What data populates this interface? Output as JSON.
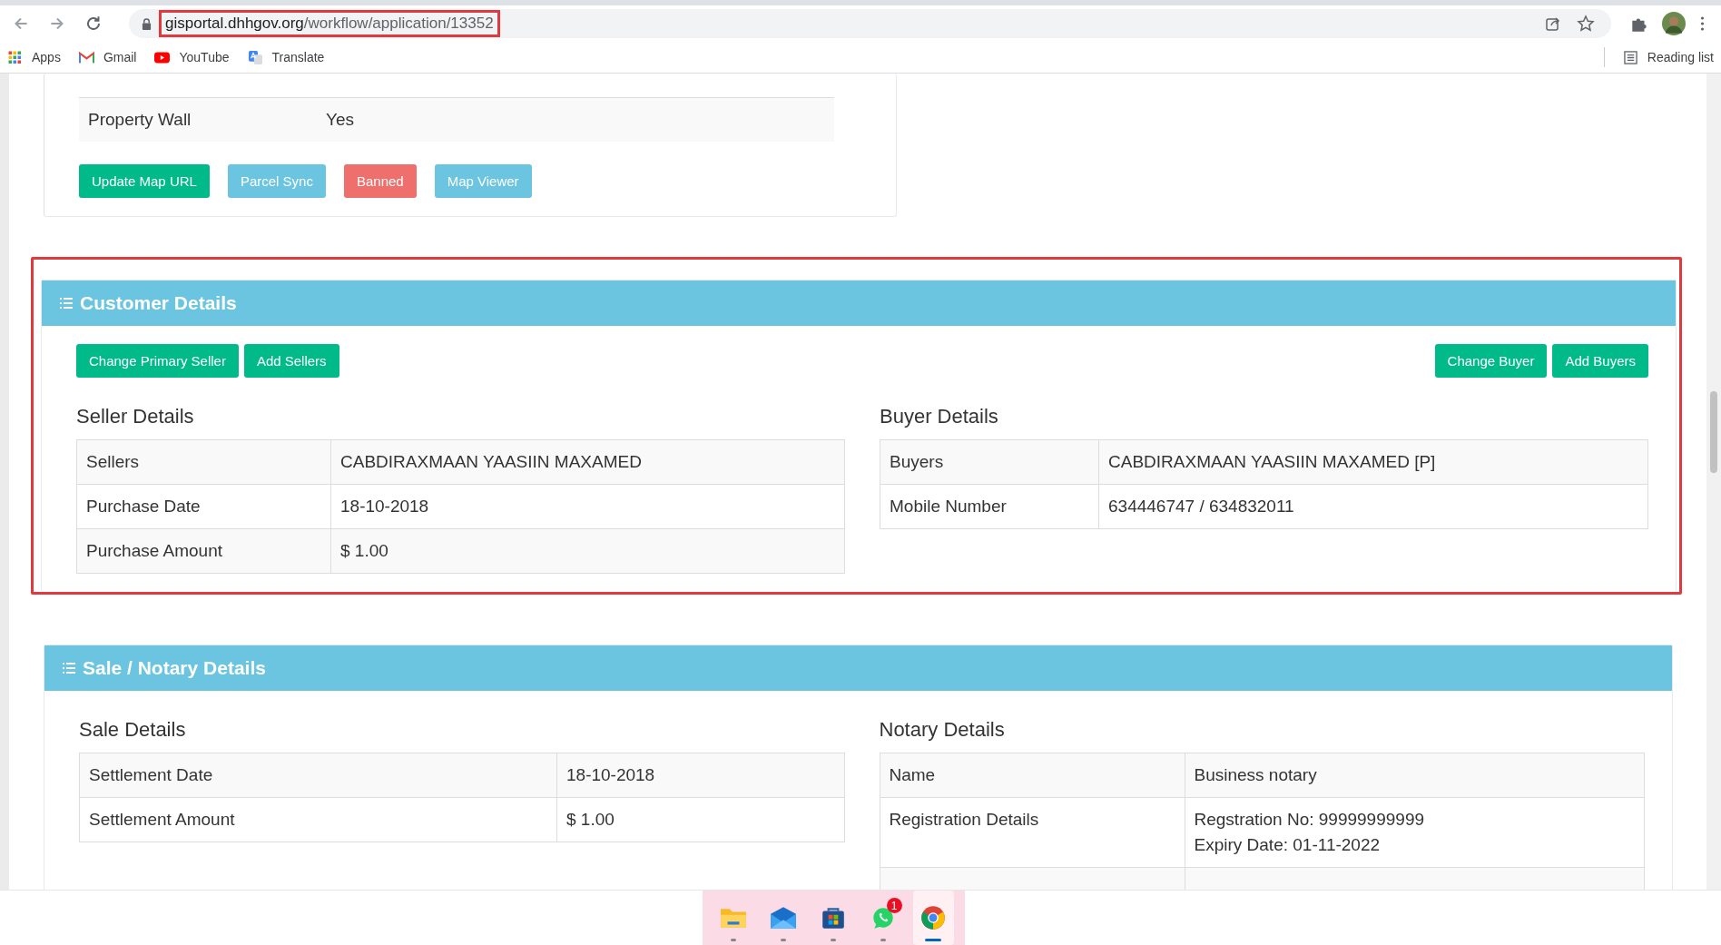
{
  "browser": {
    "url_host": "gisportal.dhhgov.org",
    "url_path": "/workflow/application/13352",
    "url_highlighted": true,
    "bookmarks": [
      {
        "kind": "apps",
        "label": "Apps"
      },
      {
        "kind": "gmail",
        "label": "Gmail"
      },
      {
        "kind": "youtube",
        "label": "YouTube"
      },
      {
        "kind": "translate",
        "label": "Translate"
      }
    ],
    "reading_list": "Reading list"
  },
  "property_table": {
    "rows": [
      {
        "label": "Property Wall",
        "value": "Yes"
      }
    ]
  },
  "property_actions": [
    {
      "label": "Update Map URL",
      "kind": "success"
    },
    {
      "label": "Parcel Sync",
      "kind": "info"
    },
    {
      "label": "Banned",
      "kind": "danger"
    },
    {
      "label": "Map Viewer",
      "kind": "info"
    }
  ],
  "customer_section": {
    "title": "Customer Details",
    "highlighted": true,
    "seller_actions": [
      {
        "label": "Change Primary Seller",
        "kind": "success"
      },
      {
        "label": "Add Sellers",
        "kind": "success"
      }
    ],
    "buyer_actions": [
      {
        "label": "Change Buyer",
        "kind": "success"
      },
      {
        "label": "Add Buyers",
        "kind": "success"
      }
    ],
    "seller": {
      "heading": "Seller Details",
      "rows": [
        {
          "label": "Sellers",
          "value": [
            "CABDIRAXMAAN YAASIIN MAXAMED"
          ]
        },
        {
          "label": "Purchase Date",
          "value": [
            "18-10-2018"
          ]
        },
        {
          "label": "Purchase Amount",
          "value": [
            "$ 1.00"
          ]
        }
      ]
    },
    "buyer": {
      "heading": "Buyer Details",
      "rows": [
        {
          "label": "Buyers",
          "value": [
            "CABDIRAXMAAN YAASIIN MAXAMED [P]"
          ]
        },
        {
          "label": "Mobile Number",
          "value": [
            "634446747 / 634832011"
          ]
        }
      ]
    }
  },
  "sale_section": {
    "title": "Sale / Notary Details",
    "sale": {
      "heading": "Sale Details",
      "rows": [
        {
          "label": "Settlement Date",
          "value": [
            "18-10-2018"
          ]
        },
        {
          "label": "Settlement Amount",
          "value": [
            "$ 1.00"
          ]
        }
      ]
    },
    "notary": {
      "heading": "Notary Details",
      "rows": [
        {
          "label": "Name",
          "value": [
            "Business notary"
          ]
        },
        {
          "label": "Registration Details",
          "value": [
            "Regstration No: 99999999999",
            "Expiry Date: 01-11-2022"
          ]
        }
      ]
    }
  },
  "taskbar": [
    {
      "kind": "folder",
      "active": false
    },
    {
      "kind": "mail",
      "active": false
    },
    {
      "kind": "store",
      "active": false
    },
    {
      "kind": "whatsapp",
      "active": false,
      "badge": "1"
    },
    {
      "kind": "chrome",
      "active": true
    }
  ]
}
